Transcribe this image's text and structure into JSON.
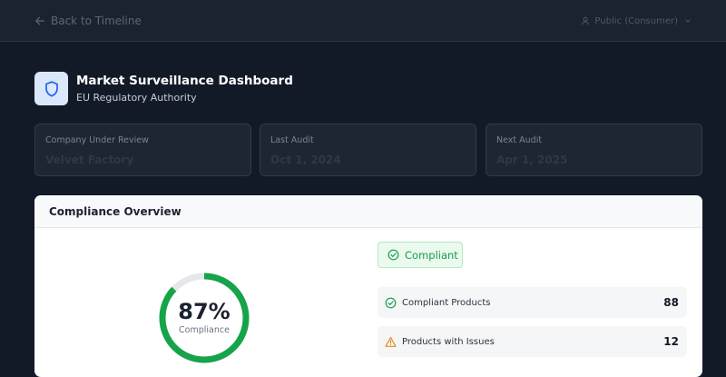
{
  "topbar": {
    "back_label": "Back to Timeline",
    "role_label": "Public (Consumer)"
  },
  "header": {
    "title": "Market Surveillance Dashboard",
    "subtitle": "EU Regulatory Authority",
    "icon": "shield-icon"
  },
  "info_cards": [
    {
      "label": "Company Under Review",
      "value": "Velvet Factory"
    },
    {
      "label": "Last Audit",
      "value": "Oct 1, 2024"
    },
    {
      "label": "Next Audit",
      "value": "Apr 1, 2025"
    }
  ],
  "overview": {
    "title": "Compliance Overview",
    "percent": 87,
    "percent_label": "87%",
    "percent_caption": "Compliance",
    "status": "Compliant",
    "stats": [
      {
        "label": "Compliant Products",
        "value": "88",
        "icon": "check-circle-icon"
      },
      {
        "label": "Products with Issues",
        "value": "12",
        "icon": "warning-triangle-icon"
      }
    ]
  },
  "colors": {
    "background": "#131a27",
    "accent_green": "#1e9a46",
    "warning_orange": "#e38a1c",
    "shield_blue": "#2563eb"
  }
}
